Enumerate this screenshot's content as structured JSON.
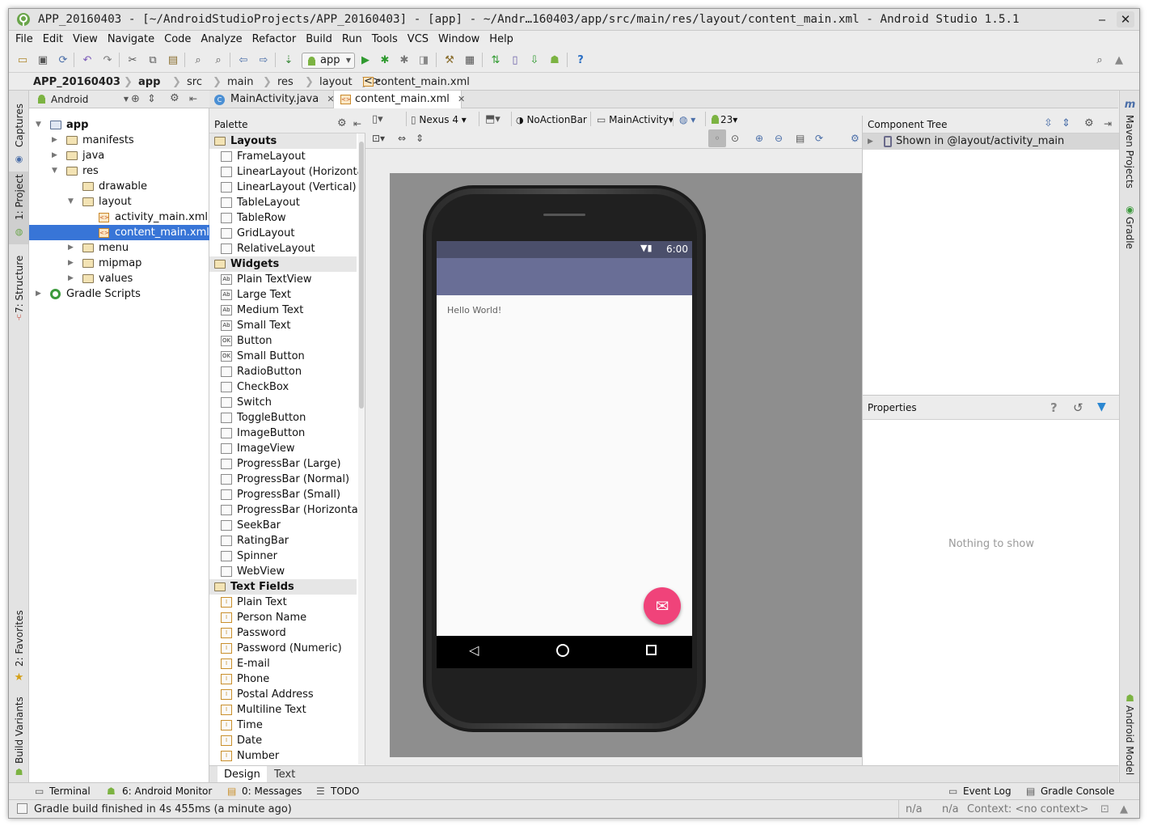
{
  "window": {
    "title": "APP_20160403 - [~/AndroidStudioProjects/APP_20160403] - [app] - ~/Andr…160403/app/src/main/res/layout/content_main.xml - Android Studio 1.5.1",
    "minimize": "‒",
    "close": "✕"
  },
  "menu": [
    "File",
    "Edit",
    "View",
    "Navigate",
    "Code",
    "Analyze",
    "Refactor",
    "Build",
    "Run",
    "Tools",
    "VCS",
    "Window",
    "Help"
  ],
  "toolbar": {
    "run_config": "app"
  },
  "breadcrumb": [
    "APP_20160403",
    "app",
    "src",
    "main",
    "res",
    "layout",
    "content_main.xml"
  ],
  "left_strip": [
    "1: Project",
    "7: Structure",
    "Captures",
    "2: Favorites",
    "Build Variants"
  ],
  "right_strip": [
    "Maven Projects",
    "Gradle",
    "Android Model"
  ],
  "project": {
    "view_mode": "Android",
    "tree": [
      {
        "label": "app",
        "depth": 0,
        "bold": true,
        "kind": "module",
        "open": true
      },
      {
        "label": "manifests",
        "depth": 1,
        "kind": "folder"
      },
      {
        "label": "java",
        "depth": 1,
        "kind": "folder"
      },
      {
        "label": "res",
        "depth": 1,
        "kind": "folder",
        "open": true
      },
      {
        "label": "drawable",
        "depth": 2,
        "kind": "folder",
        "leaf": true
      },
      {
        "label": "layout",
        "depth": 2,
        "kind": "folder",
        "open": true
      },
      {
        "label": "activity_main.xml",
        "depth": 3,
        "kind": "xml"
      },
      {
        "label": "content_main.xml",
        "depth": 3,
        "kind": "xml",
        "selected": true
      },
      {
        "label": "menu",
        "depth": 2,
        "kind": "folder"
      },
      {
        "label": "mipmap",
        "depth": 2,
        "kind": "folder"
      },
      {
        "label": "values",
        "depth": 2,
        "kind": "folder"
      },
      {
        "label": "Gradle Scripts",
        "depth": 0,
        "kind": "gradle"
      }
    ]
  },
  "editor_tabs": [
    {
      "label": "MainActivity.java",
      "selected": false
    },
    {
      "label": "content_main.xml",
      "selected": true
    }
  ],
  "palette": {
    "title": "Palette",
    "groups": [
      {
        "name": "Layouts",
        "items": [
          "FrameLayout",
          "LinearLayout (Horizontal)",
          "LinearLayout (Vertical)",
          "TableLayout",
          "TableRow",
          "GridLayout",
          "RelativeLayout"
        ]
      },
      {
        "name": "Widgets",
        "items": [
          "Plain TextView",
          "Large Text",
          "Medium Text",
          "Small Text",
          "Button",
          "Small Button",
          "RadioButton",
          "CheckBox",
          "Switch",
          "ToggleButton",
          "ImageButton",
          "ImageView",
          "ProgressBar (Large)",
          "ProgressBar (Normal)",
          "ProgressBar (Small)",
          "ProgressBar (Horizontal)",
          "SeekBar",
          "RatingBar",
          "Spinner",
          "WebView"
        ]
      },
      {
        "name": "Text Fields",
        "items": [
          "Plain Text",
          "Person Name",
          "Password",
          "Password (Numeric)",
          "E-mail",
          "Phone",
          "Postal Address",
          "Multiline Text",
          "Time",
          "Date",
          "Number"
        ]
      }
    ]
  },
  "design_toolbar": {
    "device": "Nexus 4",
    "theme": "NoActionBar",
    "activity": "MainActivity",
    "api": "23"
  },
  "preview": {
    "status_time": "6:00",
    "text": "Hello World!",
    "appbar_color": "#696e96",
    "fab_color": "#f0437a"
  },
  "component_tree": {
    "title": "Component Tree",
    "row": "Shown in @layout/activity_main"
  },
  "properties": {
    "title": "Properties",
    "empty": "Nothing to show"
  },
  "bottom_tabs": [
    {
      "label": "Design",
      "selected": true
    },
    {
      "label": "Text",
      "selected": false
    }
  ],
  "tool_windows": {
    "terminal": "Terminal",
    "android_monitor": "6: Android Monitor",
    "messages": "0: Messages",
    "todo": "TODO",
    "event_log": "Event Log",
    "gradle_console": "Gradle Console"
  },
  "status": {
    "message": "Gradle build finished in 4s 455ms (a minute ago)",
    "pos1": "n/a",
    "pos2": "n/a",
    "context": "Context: <no context>"
  }
}
